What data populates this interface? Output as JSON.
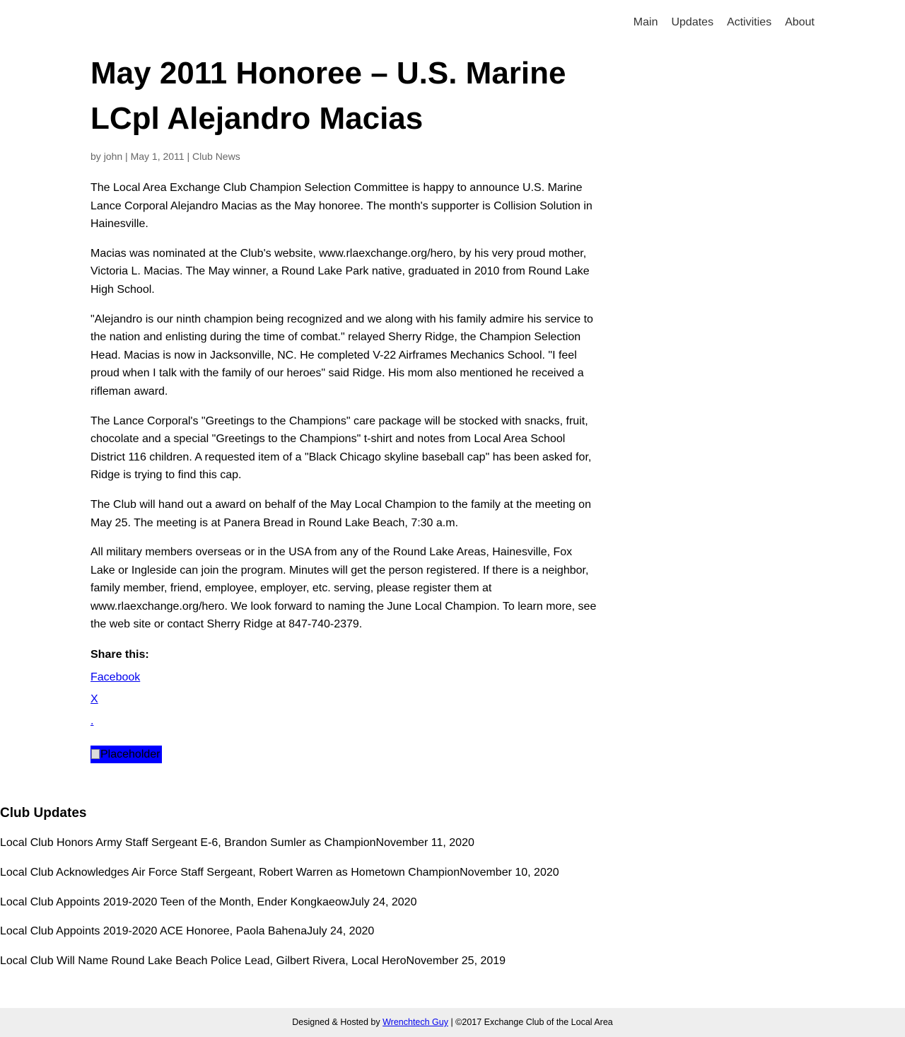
{
  "nav": {
    "items": [
      {
        "label": "Main"
      },
      {
        "label": "Updates"
      },
      {
        "label": "Activities"
      },
      {
        "label": "About"
      }
    ]
  },
  "post": {
    "title": "May 2011 Honoree – U.S. Marine LCpl Alejandro Macias",
    "meta": {
      "by": "by ",
      "author": "john",
      "sep1": " | ",
      "date": "May 1, 2011",
      "sep2": " | ",
      "category": "Club News"
    },
    "paragraphs": [
      "The Local Area Exchange Club Champion Selection Committee is happy to announce U.S. Marine Lance Corporal Alejandro Macias as the May honoree. The month's supporter is Collision Solution in Hainesville.",
      "Macias was nominated at the Club's website, www.rlaexchange.org/hero, by his very proud mother, Victoria L. Macias. The May winner, a Round Lake Park native, graduated in 2010 from Round Lake High School.",
      "\"Alejandro is our ninth champion being recognized and we along with his family admire his service to the nation and enlisting during the time of combat.\" relayed Sherry Ridge, the Champion Selection Head. Macias is now in Jacksonville, NC. He completed V-22 Airframes Mechanics School. \"I feel proud when I talk with the family of our heroes\" said Ridge. His mom also mentioned he received a rifleman award.",
      "The Lance Corporal's \"Greetings to the Champions\" care package will be stocked with snacks, fruit, chocolate and a special \"Greetings to the Champions\" t-shirt and notes from Local Area School District 116 children. A requested item of a \"Black Chicago skyline baseball cap\" has been asked for, Ridge is trying to find this cap.",
      "The Club will hand out a award on behalf of the May Local Champion to the family at the meeting on May 25. The meeting is at Panera Bread in Round Lake Beach, 7:30 a.m.",
      "All military members overseas or in the USA from any of the Round Lake Areas, Hainesville, Fox Lake or Ingleside can join the program. Minutes will get the person registered. If there is a neighbor, family member, friend, employee, employer, etc. serving, please register them at www.rlaexchange.org/hero. We look forward to naming the June Local Champion. To learn more, see the web site or contact Sherry Ridge at 847-740-2379."
    ]
  },
  "share": {
    "heading": "Share this:",
    "links": [
      {
        "label": "Facebook"
      },
      {
        "label": "X"
      },
      {
        "label": "."
      }
    ]
  },
  "placeholder_image": {
    "alt": "Placeholder",
    "background": "#0000ff"
  },
  "updates": {
    "heading": "Club Updates",
    "items": [
      {
        "title": "Local Club Honors Army Staff Sergeant E-6, Brandon Sumler as Champion",
        "date": "November 11, 2020"
      },
      {
        "title": "Local Club Acknowledges Air Force Staff Sergeant, Robert Warren as Hometown Champion",
        "date": "November 10, 2020"
      },
      {
        "title": "Local Club Appoints 2019-2020 Teen of the Month, Ender Kongkaeow",
        "date": "July 24, 2020"
      },
      {
        "title": "Local Club Appoints 2019-2020 ACE Honoree, Paola Bahena",
        "date": "July 24, 2020"
      },
      {
        "title": "Local Club Will Name Round Lake Beach Police Lead, Gilbert Rivera, Local Hero",
        "date": "November 25, 2019"
      }
    ]
  },
  "footer": {
    "prefix": "Designed & Hosted by ",
    "link": "Wrenchtech Guy",
    "suffix": " | ©2017 Exchange Club of the Local Area",
    "background": "#eeeeee"
  }
}
